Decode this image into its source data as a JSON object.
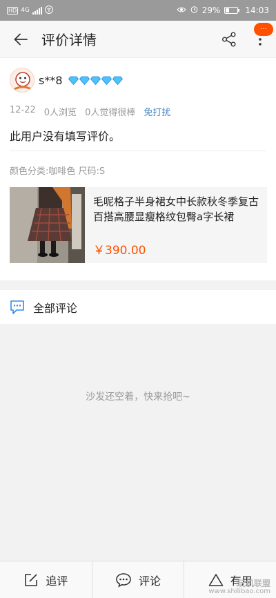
{
  "status_bar": {
    "network": "4G",
    "battery": "29%",
    "time": "14:03"
  },
  "header": {
    "title": "评价详情",
    "badge": "···"
  },
  "review": {
    "username": "s**8",
    "date": "12-22",
    "views": "0人浏览",
    "likes": "0人觉得很棒",
    "free_label": "免打扰",
    "text": "此用户没有填写评价。",
    "sku": "颜色分类:咖啡色 尺码:S"
  },
  "product": {
    "title": "毛呢格子半身裙女中长款秋冬季复古百搭高腰显瘦格纹包臀a字长裙",
    "price": "￥390.00"
  },
  "comments": {
    "title": "全部评论",
    "empty": "沙发还空着，快来抢吧~"
  },
  "bottom": {
    "follow_review": "追评",
    "comment": "评论",
    "useful": "有用"
  },
  "watermark": {
    "line1": "玩机联盟",
    "line2": "www.shilibao.com"
  },
  "colors": {
    "accent": "#ff5000",
    "link": "#3d7fbf"
  }
}
